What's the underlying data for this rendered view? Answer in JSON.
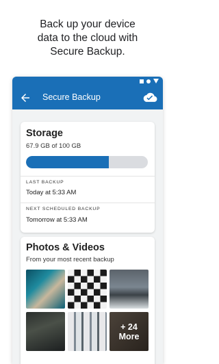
{
  "promo": {
    "line1": "Back up your device",
    "line2": "data to the cloud with",
    "line3": "Secure Backup."
  },
  "app": {
    "title": "Secure Backup",
    "back_icon": "arrow-back-icon",
    "cloud_icon": "cloud-check-icon",
    "accent": "#1a6fb7"
  },
  "storage": {
    "title": "Storage",
    "used_text": "67.9 GB of 100 GB",
    "used_fraction": 0.679,
    "last_backup_label": "LAST BACKUP",
    "last_backup_value": "Today at 5:33 AM",
    "next_backup_label": "NEXT SCHEDULED BACKUP",
    "next_backup_value": "Tomorrow at 5:33 AM"
  },
  "photos": {
    "title": "Photos & Videos",
    "subtitle": "From your most recent backup",
    "more_count": "+ 24",
    "more_label": "More"
  }
}
